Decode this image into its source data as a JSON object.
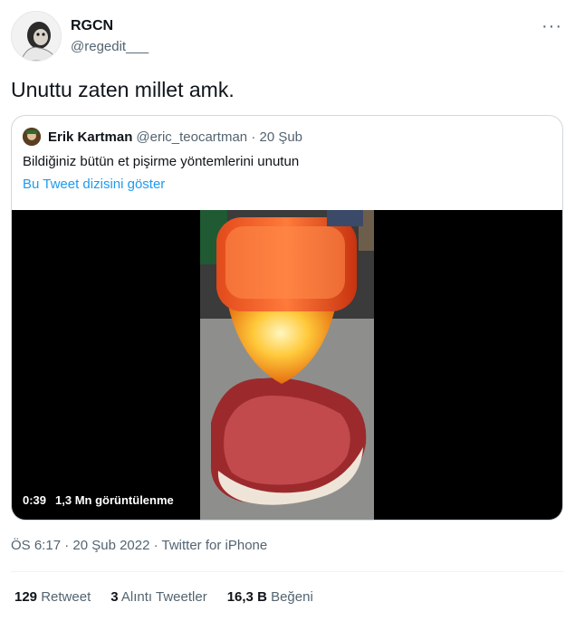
{
  "author": {
    "name": "RGCN",
    "handle": "@regedit___"
  },
  "more_label": "···",
  "tweet": {
    "text": "Unuttu zaten millet amk."
  },
  "quote": {
    "name": "Erik Kartman",
    "meta": "@eric_teocartman · 20 Şub",
    "text": "Bildiğiniz bütün et pişirme yöntemlerini unutun",
    "thread_link": "Bu Tweet dizisini göster",
    "video": {
      "duration": "0:39",
      "views": "1,3 Mn görüntülenme"
    }
  },
  "timestamp": "ÖS 6:17 · 20 Şub 2022 · Twitter for iPhone",
  "stats": [
    {
      "value": "129",
      "label": "Retweet"
    },
    {
      "value": "3",
      "label": "Alıntı Tweetler"
    },
    {
      "value": "16,3 B",
      "label": "Beğeni"
    }
  ]
}
